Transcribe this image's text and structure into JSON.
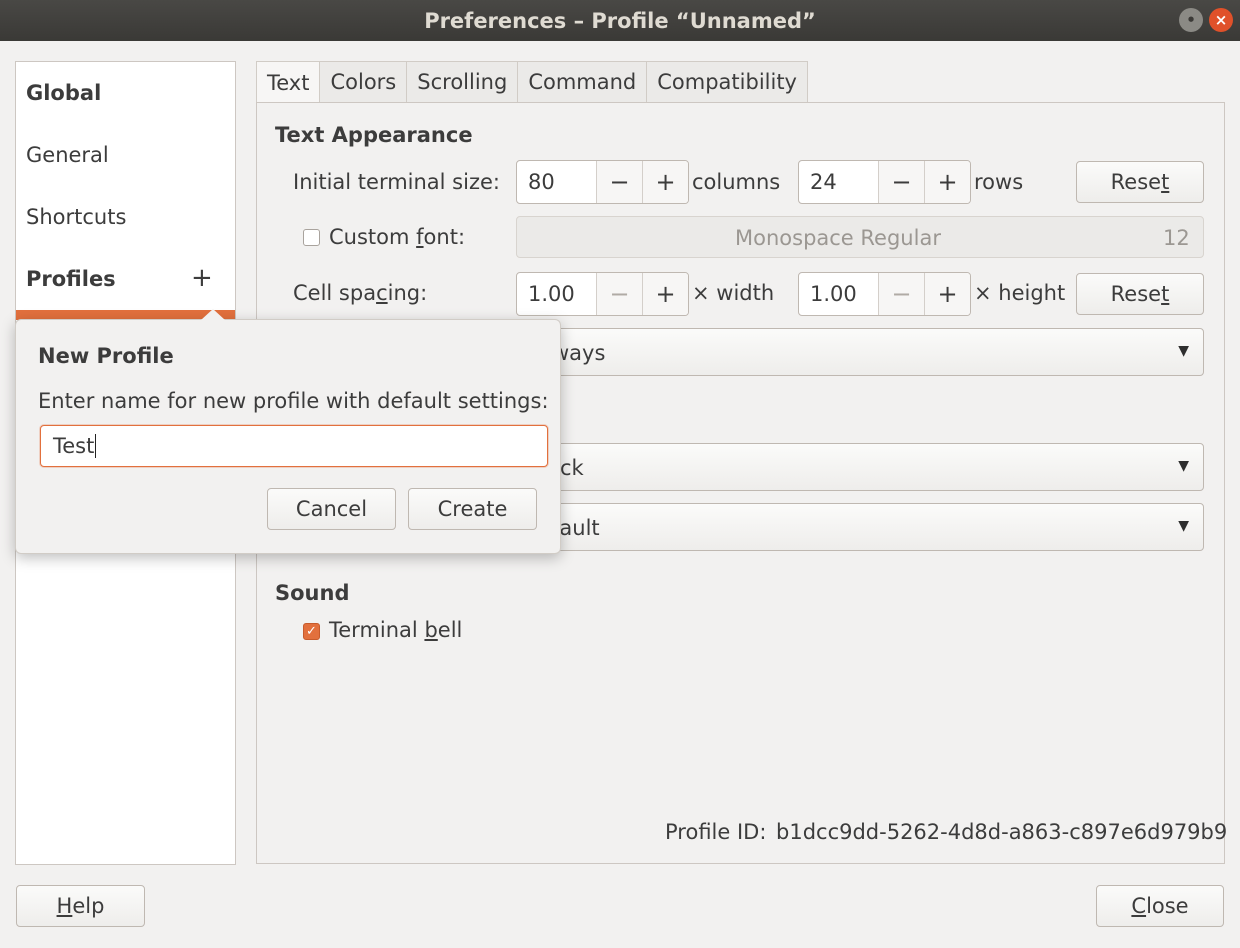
{
  "window": {
    "title": "Preferences – Profile “Unnamed”",
    "min_glyph": "•",
    "close_glyph": "×"
  },
  "sidebar": {
    "global": "Global",
    "general": "General",
    "shortcuts": "Shortcuts",
    "profiles": "Profiles",
    "add_glyph": "+"
  },
  "tabs": [
    "Text",
    "Colors",
    "Scrolling",
    "Command",
    "Compatibility"
  ],
  "text_tab": {
    "appearance_heading": "Text Appearance",
    "initial_size_label": "Initial terminal size:",
    "columns_value": "80",
    "columns_unit": "columns",
    "rows_value": "24",
    "rows_unit": "rows",
    "reset_a": {
      "pre": "Rese",
      "mn": "t",
      "post": ""
    },
    "custom_font": {
      "pre": "Custom ",
      "mn": "f",
      "post": "ont:"
    },
    "font_name": "Monospace Regular",
    "font_size": "12",
    "cell_spacing": {
      "pre": "Cell spa",
      "mn": "c",
      "post": "ing:"
    },
    "width_value": "1.00",
    "width_unit": "× width",
    "height_value": "1.00",
    "height_unit": "× height",
    "reset_b": {
      "pre": "Rese",
      "mn": "t",
      "post": ""
    },
    "combo1_visible": "ways",
    "combo2_visible": "ck",
    "combo3_visible": "fault",
    "sound_heading": "Sound",
    "terminal_bell": {
      "pre": "Terminal ",
      "mn": "b",
      "post": "ell"
    },
    "profile_id_label": "Profile ID:",
    "profile_id_value": "b1dcc9dd-5262-4d8d-a863-c897e6d979b9",
    "minus": "−",
    "plus": "+",
    "arrow": "▼",
    "check": "✓"
  },
  "popover": {
    "title": "New Profile",
    "prompt": "Enter name for new profile with default settings:",
    "input_value": "Test",
    "cancel": "Cancel",
    "create": "Create"
  },
  "footer": {
    "help": {
      "mn": "H",
      "post": "elp"
    },
    "close": {
      "mn": "C",
      "post": "lose"
    }
  }
}
